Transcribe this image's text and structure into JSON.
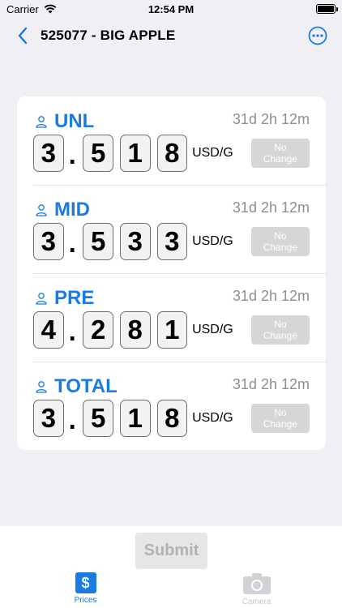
{
  "status_bar": {
    "carrier": "Carrier",
    "time": "12:54 PM"
  },
  "nav": {
    "title": "525077 - BIG APPLE"
  },
  "colors": {
    "accent": "#1a7be0",
    "badge_bg": "#d6d6d6",
    "background": "#efeff4"
  },
  "grades": [
    {
      "label": "UNL",
      "age": "31d 2h 12m",
      "digits": [
        "3",
        "5",
        "1",
        "8"
      ],
      "dot": ".",
      "unit": "USD/G",
      "status": "No Change"
    },
    {
      "label": "MID",
      "age": "31d 2h 12m",
      "digits": [
        "3",
        "5",
        "3",
        "3"
      ],
      "dot": ".",
      "unit": "USD/G",
      "status": "No Change"
    },
    {
      "label": "PRE",
      "age": "31d 2h 12m",
      "digits": [
        "4",
        "2",
        "8",
        "1"
      ],
      "dot": ".",
      "unit": "USD/G",
      "status": "No Change"
    },
    {
      "label": "TOTAL",
      "age": "31d 2h 12m",
      "digits": [
        "3",
        "5",
        "1",
        "8"
      ],
      "dot": ".",
      "unit": "USD/G",
      "status": "No Change"
    }
  ],
  "submit": {
    "label": "Submit"
  },
  "tabs": [
    {
      "label": "Prices",
      "icon": "dollar-icon",
      "selected": true
    },
    {
      "label": "Camera",
      "icon": "camera-icon",
      "selected": false
    }
  ]
}
